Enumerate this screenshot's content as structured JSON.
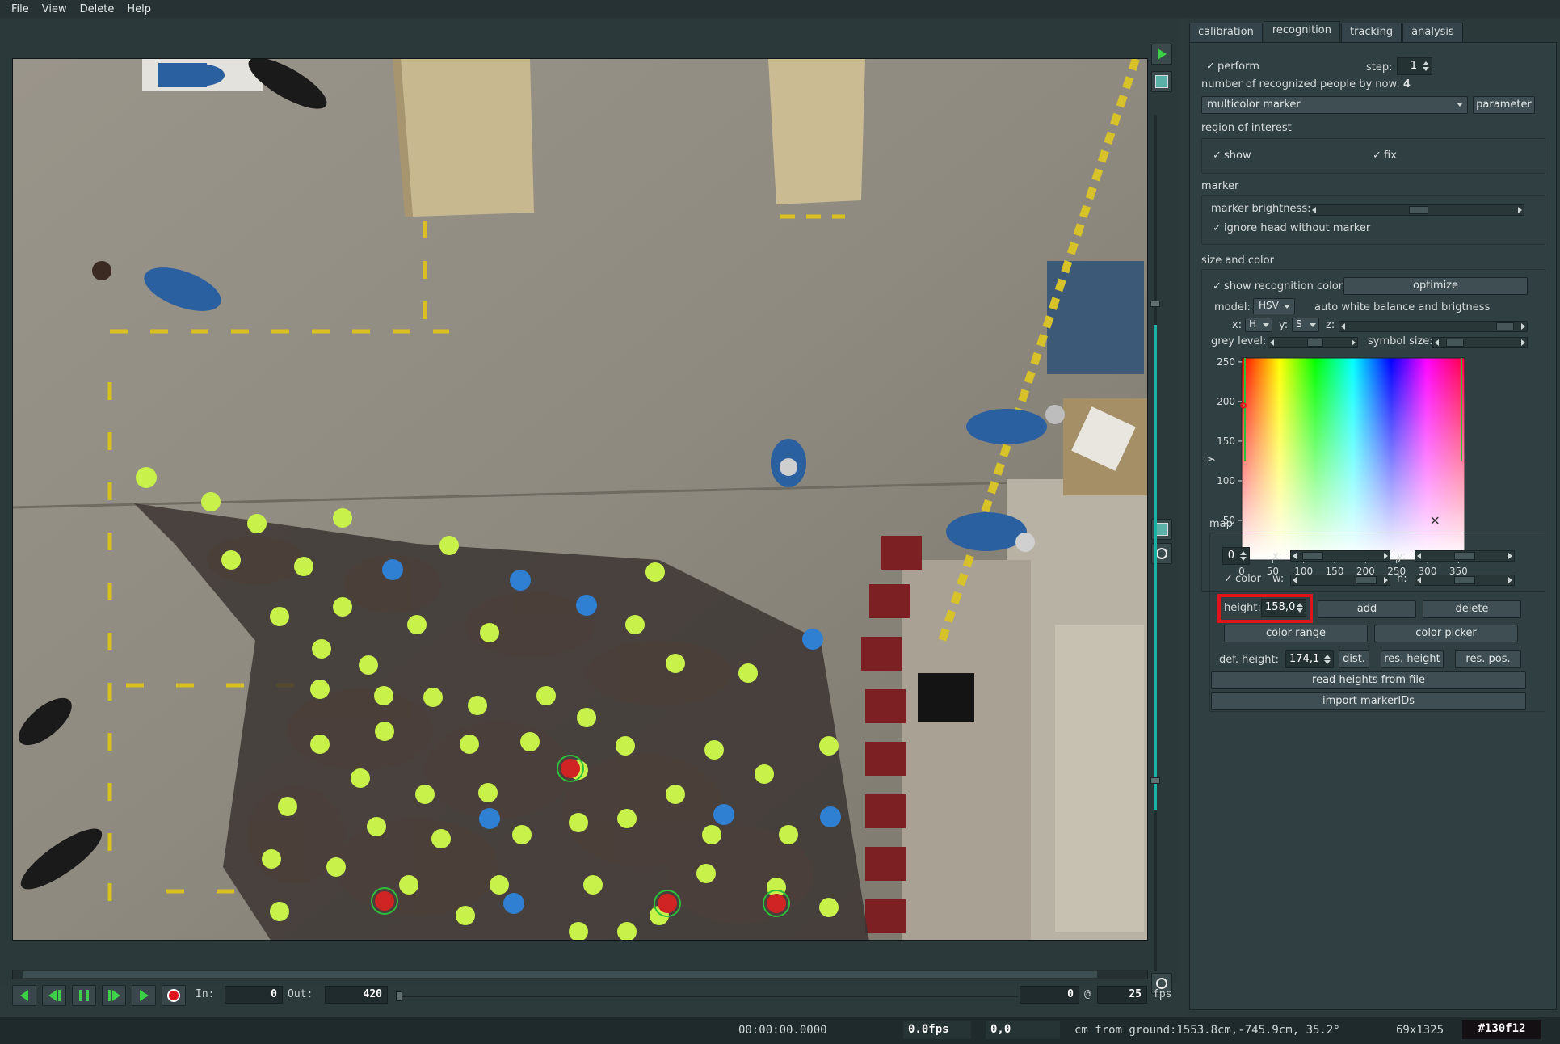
{
  "menu": [
    "File",
    "View",
    "Delete",
    "Help"
  ],
  "tabs": [
    "calibration",
    "recognition",
    "tracking",
    "analysis"
  ],
  "active_tab": "recognition",
  "recognition": {
    "perform_label": "perform",
    "perform_checked": true,
    "step_label": "step:",
    "step_value": "1",
    "recognized_count_label": "number of recognized people by now:",
    "recognized_count": "4",
    "method_value": "multicolor marker",
    "parameter_button": "parameter",
    "roi_title": "region of interest",
    "roi_show": "show",
    "roi_fix": "fix",
    "marker_title": "marker",
    "marker_brightness_label": "marker brightness:",
    "marker_brightness_level": 0.5,
    "ignore_head_label": "ignore head without marker",
    "size_color_title": "size and color",
    "show_recognition_color": "show recognition color",
    "optimize_button": "optimize",
    "model_label": "model:",
    "model_value": "HSV",
    "auto_wb_label": "auto white balance and brigtness",
    "x_label": "x:",
    "x_value": "H",
    "y_label": "y:",
    "y_value": "S",
    "z_label": "z:",
    "grey_level_label": "grey level:",
    "symbol_size_label": "symbol size:",
    "map_title": "map",
    "map_index": "0",
    "map_x_label": "x:",
    "map_y_label": "y:",
    "map_color_label": "color",
    "map_w_label": "w:",
    "map_h_label": "h:",
    "height_label": "height:",
    "height_value": "158,0",
    "add_button": "add",
    "delete_button": "delete",
    "color_range_button": "color range",
    "color_picker_button": "color picker",
    "def_height_label": "def. height:",
    "def_height_value": "174,1",
    "dist_button": "dist.",
    "res_height_button": "res. height",
    "res_pos_button": "res. pos.",
    "read_heights_button": "read heights from file",
    "import_marker_button": "import markerIDs"
  },
  "chart_data": {
    "type": "heatmap",
    "xlabel": "x",
    "ylabel": "y",
    "x_ticks": [
      0,
      50,
      100,
      150,
      200,
      250,
      300,
      350
    ],
    "y_ticks": [
      0,
      50,
      100,
      150,
      200,
      250
    ],
    "xlim": [
      0,
      360
    ],
    "ylim": [
      0,
      255
    ],
    "marker_point": {
      "x": 312,
      "y": 50
    },
    "selection_point": {
      "x": 0,
      "y": 195
    }
  },
  "player": {
    "in_label": "In:",
    "in_value": "0",
    "out_label": "Out:",
    "out_value": "420",
    "frame_value": "0",
    "at_label": "@",
    "fps_value": "25",
    "fps_label": "fps"
  },
  "status": {
    "time": "00:00:00.0000",
    "fps": "0.0fps",
    "pos": "0,0",
    "unit_text": "cm from ground:1553.8cm,-745.9cm, 35.2°",
    "pixel": "69x1325",
    "color_hex": "#130f12"
  },
  "scene": {
    "accent_green": "#c8f24a",
    "accent_blue": "#2f7fd2",
    "accent_red": "#e0141b"
  }
}
